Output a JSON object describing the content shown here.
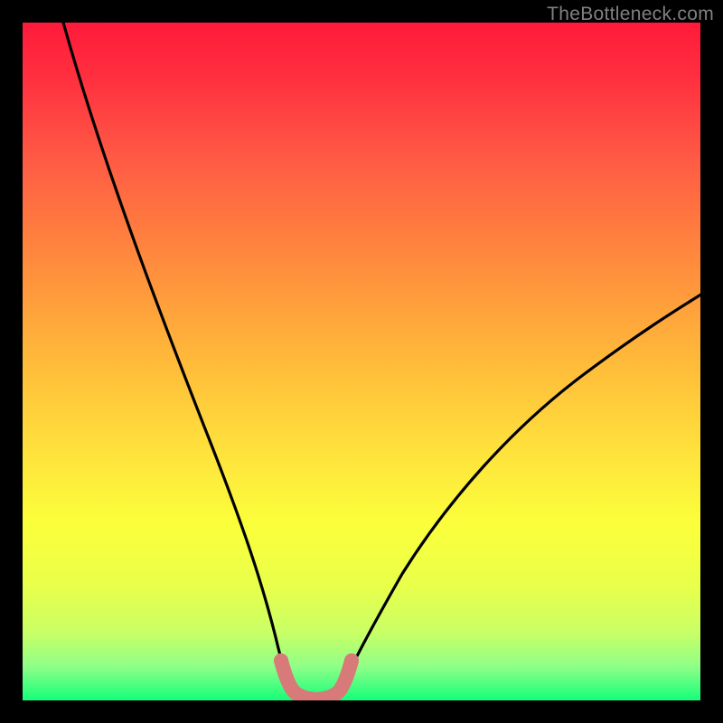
{
  "watermark": "TheBottleneck.com",
  "chart_data": {
    "type": "line",
    "title": "",
    "xlabel": "",
    "ylabel": "",
    "xlim": [
      0,
      100
    ],
    "ylim": [
      0,
      100
    ],
    "left_branch": {
      "x": [
        6,
        10,
        14,
        18,
        22,
        26,
        30,
        33,
        35.5,
        37
      ],
      "y": [
        100,
        82,
        66,
        52,
        40,
        29,
        19,
        10,
        4.5,
        1.5
      ]
    },
    "right_branch": {
      "x": [
        44,
        46,
        50,
        55,
        62,
        70,
        80,
        90,
        100
      ],
      "y": [
        1.5,
        4,
        10,
        18,
        28,
        37,
        46.5,
        54.5,
        61
      ]
    },
    "trough_segment": {
      "comment": "salmon-pink rounded segment at the bottom joining the branches",
      "color": "#d87a79",
      "x": [
        36,
        37.5,
        39,
        41,
        43,
        44.5,
        45.5
      ],
      "y": [
        5.5,
        2.5,
        1.2,
        1.0,
        1.2,
        2.5,
        5.5
      ]
    },
    "gradient_stops": [
      {
        "pos": 0.0,
        "color": "#ff1a3a"
      },
      {
        "pos": 0.2,
        "color": "#ff5a45"
      },
      {
        "pos": 0.4,
        "color": "#ff9a3c"
      },
      {
        "pos": 0.63,
        "color": "#ffe13c"
      },
      {
        "pos": 0.83,
        "color": "#e9ff4a"
      },
      {
        "pos": 1.0,
        "color": "#14ff7a"
      }
    ]
  }
}
